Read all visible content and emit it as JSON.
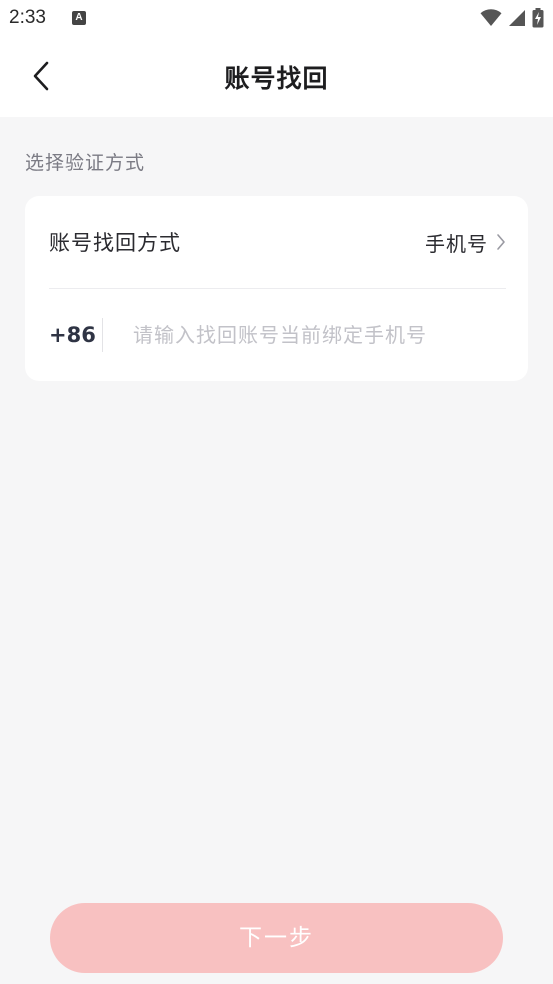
{
  "status_bar": {
    "time": "2:33",
    "notification_icon": "a-app-icon",
    "icons": [
      "wifi-icon",
      "cellular-signal-icon",
      "battery-charging-icon"
    ]
  },
  "header": {
    "title": "账号找回",
    "back_icon": "chevron-left-icon"
  },
  "section": {
    "label": "选择验证方式"
  },
  "recovery_card": {
    "method_label": "账号找回方式",
    "method_value": "手机号",
    "country_code": "+86",
    "phone_placeholder": "请输入找回账号当前绑定手机号",
    "phone_value": ""
  },
  "footer": {
    "next_label": "下一步"
  },
  "colors": {
    "background": "#f6f6f7",
    "card": "#ffffff",
    "button_disabled": "#f8c1c1",
    "placeholder": "#c2c2c8",
    "section_label": "#7b7b84"
  }
}
